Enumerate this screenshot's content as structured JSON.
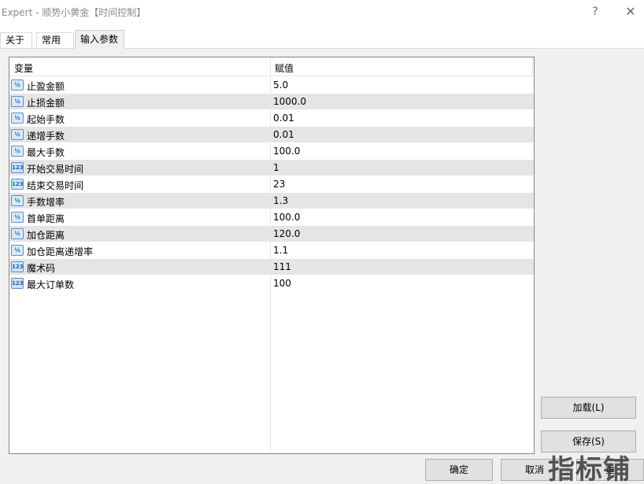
{
  "window": {
    "title": "Expert - 顺势小黄金【时间控制】",
    "help_glyph": "?",
    "close_glyph": "✕"
  },
  "tabs": [
    {
      "label": "关于"
    },
    {
      "label": "常用"
    },
    {
      "label": "输入参数"
    }
  ],
  "table": {
    "columns": [
      "变量",
      "赋值"
    ],
    "rows": [
      {
        "icon": "double-param-icon",
        "icon_text": "½",
        "name": "止盈金额",
        "value": "5.0"
      },
      {
        "icon": "double-param-icon",
        "icon_text": "½",
        "name": "止损金额",
        "value": "1000.0"
      },
      {
        "icon": "double-param-icon",
        "icon_text": "½",
        "name": "起始手数",
        "value": "0.01"
      },
      {
        "icon": "double-param-icon",
        "icon_text": "½",
        "name": "递增手数",
        "value": "0.01"
      },
      {
        "icon": "double-param-icon",
        "icon_text": "½",
        "name": "最大手数",
        "value": "100.0"
      },
      {
        "icon": "integer-param-icon",
        "icon_text": "123",
        "name": "开始交易时间",
        "value": "1"
      },
      {
        "icon": "integer-param-icon",
        "icon_text": "123",
        "name": "结束交易时间",
        "value": "23"
      },
      {
        "icon": "double-param-icon",
        "icon_text": "½",
        "name": "手数增率",
        "value": "1.3"
      },
      {
        "icon": "double-param-icon",
        "icon_text": "½",
        "name": "首单距离",
        "value": "100.0"
      },
      {
        "icon": "double-param-icon",
        "icon_text": "½",
        "name": "加仓距离",
        "value": "120.0"
      },
      {
        "icon": "double-param-icon",
        "icon_text": "½",
        "name": "加仓距离递增率",
        "value": "1.1"
      },
      {
        "icon": "integer-param-icon",
        "icon_text": "123",
        "name": "魔术码",
        "value": "111"
      },
      {
        "icon": "integer-param-icon",
        "icon_text": "123",
        "name": "最大订单数",
        "value": "100"
      }
    ]
  },
  "buttons": {
    "load": "加载(L)",
    "save": "保存(S)",
    "ok": "确定",
    "cancel": "取消",
    "reset": "重"
  },
  "watermark": "指标铺",
  "colors": {
    "alt_row": "#e5e5e5",
    "icon_border": "#5a8fc6",
    "icon_fill": "#d7ebfb"
  }
}
